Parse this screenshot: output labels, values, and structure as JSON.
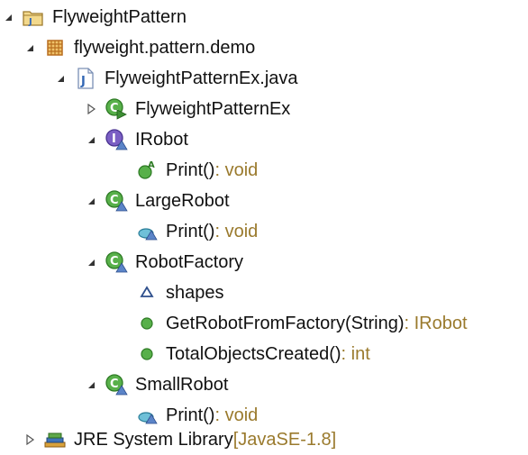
{
  "tree": {
    "project": {
      "label": "FlyweightPattern",
      "expanded": true,
      "icon": "java-project-icon"
    },
    "package": {
      "label": "flyweight.pattern.demo",
      "expanded": true,
      "icon": "package-icon"
    },
    "file": {
      "label": "FlyweightPatternEx.java",
      "expanded": true,
      "icon": "java-file-icon"
    },
    "items": [
      {
        "key": "flyweight_class",
        "label": "FlyweightPatternEx",
        "decor": "",
        "expanded": false,
        "icon": "class-runnable-icon",
        "kind": "class"
      },
      {
        "key": "irobot",
        "label": "IRobot",
        "decor": "",
        "expanded": true,
        "icon": "interface-icon",
        "kind": "interface"
      },
      {
        "key": "irobot_print",
        "label": "Print()",
        "decor": " : void",
        "icon": "abstract-method-icon",
        "kind": "method"
      },
      {
        "key": "largerobot",
        "label": "LargeRobot",
        "decor": "",
        "expanded": true,
        "icon": "class-icon",
        "kind": "class"
      },
      {
        "key": "largerobot_print",
        "label": "Print()",
        "decor": " : void",
        "icon": "default-method-icon",
        "kind": "method"
      },
      {
        "key": "robotfactory",
        "label": "RobotFactory",
        "decor": "",
        "expanded": true,
        "icon": "class-icon",
        "kind": "class"
      },
      {
        "key": "robotfactory_shapes",
        "label": "shapes",
        "decor": "",
        "icon": "field-icon",
        "kind": "field"
      },
      {
        "key": "robotfactory_get",
        "label": "GetRobotFromFactory(String)",
        "decor": " : IRobot",
        "icon": "public-method-icon",
        "kind": "method"
      },
      {
        "key": "robotfactory_total",
        "label": "TotalObjectsCreated()",
        "decor": " : int",
        "icon": "public-method-icon",
        "kind": "method"
      },
      {
        "key": "smallrobot",
        "label": "SmallRobot",
        "decor": "",
        "expanded": true,
        "icon": "class-icon",
        "kind": "class"
      },
      {
        "key": "smallrobot_print",
        "label": "Print()",
        "decor": " : void",
        "icon": "default-method-icon",
        "kind": "method"
      }
    ],
    "jre": {
      "label": "JRE System Library",
      "decor": " [JavaSE-1.8]",
      "expanded": false,
      "icon": "library-icon"
    }
  },
  "colors": {
    "class_green": "#3d9a32",
    "interface_purple": "#6a4fb5",
    "package_orange": "#c8852a",
    "decoration_brown": "#9a7a2d",
    "twisty": "#333333"
  }
}
